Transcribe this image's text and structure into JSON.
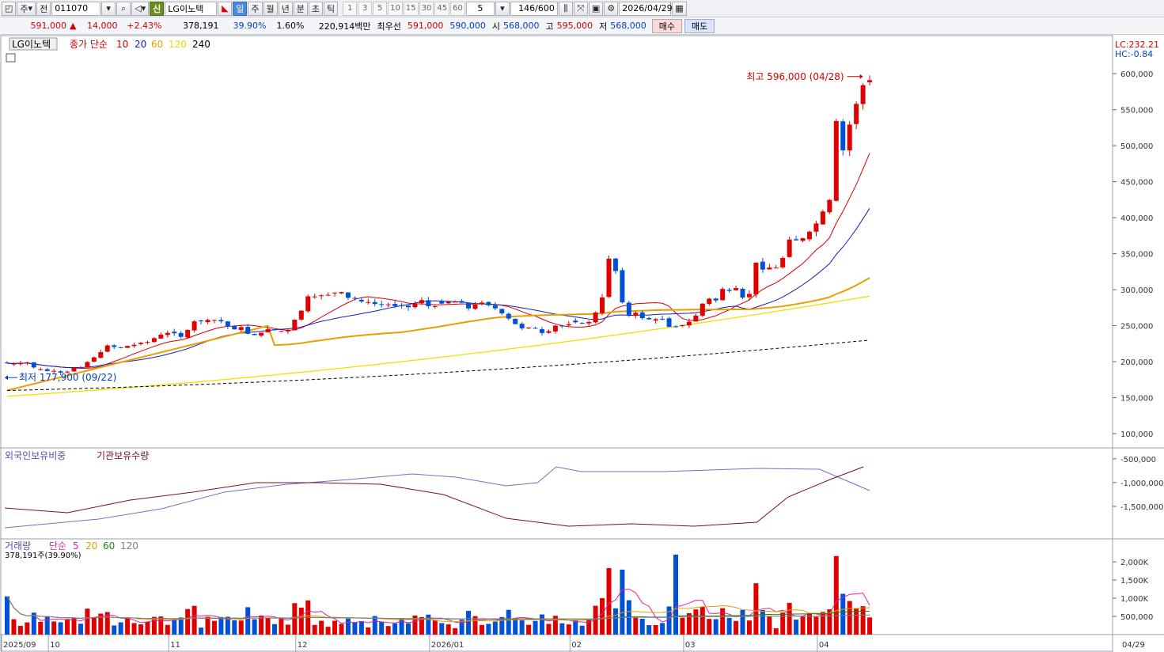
{
  "toolbar": {
    "market": "주",
    "prev_label": "전",
    "code": "011070",
    "sin_label": "신",
    "stock_name": "LG이노텍",
    "periods": [
      "일",
      "주",
      "월",
      "년",
      "분",
      "초",
      "틱"
    ],
    "active_period": "일",
    "minute_options": [
      "1",
      "3",
      "5",
      "10",
      "15",
      "30",
      "45",
      "60"
    ],
    "minute_value": "5",
    "count": "146",
    "count_total": "/600",
    "date": "2026/04/29"
  },
  "infobar": {
    "price": "591,000",
    "change_arrow": "▲",
    "change": "14,000",
    "change_pct": "+2.43%",
    "volume": "378,191",
    "vol_ratio": "39.90%",
    "turnover_pct": "1.60%",
    "amount": "220,914백만",
    "best_quote_label": "최우선",
    "best_ask": "591,000",
    "best_bid": "590,000",
    "open_label": "시",
    "open": "568,000",
    "high_label": "고",
    "high": "595,000",
    "low_label": "저",
    "low": "568,000",
    "buy_label": "매수",
    "sell_label": "매도"
  },
  "legend": {
    "name": "LG이노텍",
    "ma_label": "종가 단순",
    "ma_periods": [
      "10",
      "20",
      "60",
      "120",
      "240"
    ],
    "ma_colors": [
      "#d40000",
      "#1020c0",
      "#e8a000",
      "#f0e000",
      "#000000"
    ],
    "lc": "LC:232.21",
    "hc": "HC:-0.84",
    "max_label": "최고 596,000 (04/28)",
    "min_label": "최저 177,900 (09/22)"
  },
  "panel2": {
    "label_foreign": "외국인보유비중",
    "label_inst": "기관보유수량",
    "ticks": [
      "-500,000",
      "-1,000,000",
      "-1,500,000"
    ],
    "colors": {
      "foreign": "#7070c8",
      "inst": "#7a1020"
    }
  },
  "panel3": {
    "label": "거래량",
    "ma_label": "단순",
    "ma_periods": [
      "5",
      "20",
      "60",
      "120"
    ],
    "ma_colors": [
      "#e020a0",
      "#e0a000",
      "#208020",
      "#808080"
    ],
    "sub_label": "378,191주(39.90%)",
    "ticks": [
      "2,000K",
      "1,500K",
      "1,000K",
      "500,000"
    ]
  },
  "xaxis": {
    "labels": [
      "2025/09",
      "10",
      "11",
      "12",
      "2026/01",
      "02",
      "03",
      "04"
    ],
    "right_label": "04/29"
  },
  "chart_data": {
    "type": "candlestick",
    "price_ticks": [
      100000,
      150000,
      200000,
      250000,
      300000,
      350000,
      400000,
      450000,
      500000,
      550000,
      600000
    ],
    "ylim": [
      88000,
      632000
    ],
    "up_color": "#e00000",
    "down_color": "#0050d8",
    "highest": 596000,
    "lowest": 177900,
    "close": [
      197800,
      197200,
      198100,
      198900,
      192000,
      189400,
      187000,
      187200,
      184800,
      186200,
      191700,
      191900,
      199600,
      206000,
      213200,
      222500,
      220500,
      219300,
      221900,
      223500,
      226100,
      227400,
      232600,
      237500,
      240000,
      239400,
      234500,
      244000,
      256000,
      256000,
      258000,
      258000,
      256000,
      248800,
      244800,
      248000,
      238800,
      236900,
      240300,
      245000,
      244500,
      242600,
      244200,
      258200,
      270900,
      290800,
      290600,
      292100,
      292800,
      295900,
      296700,
      288800,
      287800,
      283600,
      282800,
      280100,
      279600,
      279600,
      277300,
      278000,
      275600,
      280800,
      285500,
      277000,
      276900,
      280700,
      283100,
      283200,
      281800,
      274000,
      279200,
      282100,
      278400,
      274100,
      267100,
      259900,
      252200,
      246300,
      247400,
      245800,
      239800,
      242300,
      250100,
      249600,
      252000,
      254700,
      252800,
      255100,
      268200,
      289200,
      343000,
      325900,
      282400,
      264700,
      268000,
      260400,
      258800,
      259000,
      259500,
      248300,
      248200,
      250800,
      255500,
      264000,
      280600,
      287500,
      285000,
      301000,
      298300,
      302200,
      289100,
      294100,
      337600,
      327900,
      330700,
      330600,
      344100,
      369600,
      368500,
      371400,
      380500,
      392000,
      408600,
      424700,
      534200,
      493600,
      529300,
      558000,
      584000,
      591000
    ],
    "ma10_end": 487000,
    "ma20_end": 415000,
    "ma60_end": 321000,
    "ma120_end": 291000,
    "ma240_end": 230000,
    "volume_max_label": "2,000K"
  }
}
